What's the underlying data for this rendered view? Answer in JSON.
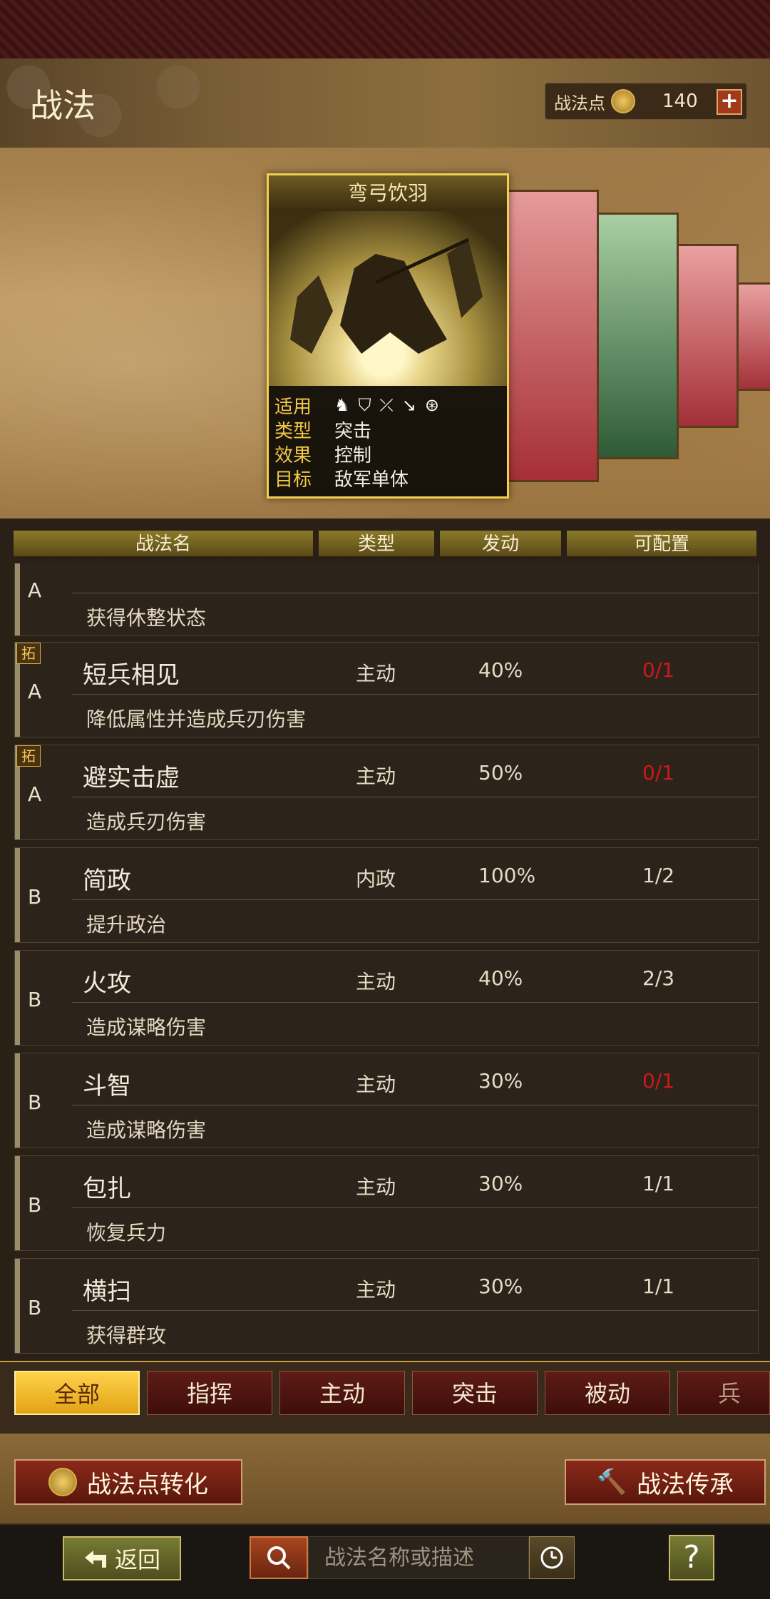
{
  "header": {
    "title": "战法",
    "points_label": "战法点",
    "points_value": "140",
    "plus_label": "+"
  },
  "featured_card": {
    "name": "弯弓饮羽",
    "info": [
      {
        "key": "适用",
        "value": ""
      },
      {
        "key": "类型",
        "value": "突击"
      },
      {
        "key": "效果",
        "value": "控制"
      },
      {
        "key": "目标",
        "value": "敌军单体"
      }
    ],
    "troop_icons": [
      "cavalry-icon",
      "shield-icon",
      "bow-icon",
      "spear-icon",
      "chariot-icon"
    ]
  },
  "table": {
    "headers": {
      "name": "战法名",
      "type": "类型",
      "activation": "发动",
      "configurable": "可配置"
    },
    "rows": [
      {
        "grade": "A",
        "tag": "",
        "name": "",
        "type": "",
        "activation": "",
        "configurable": "",
        "conf_red": false,
        "desc": "获得休整状态"
      },
      {
        "grade": "A",
        "tag": "拓",
        "name": "短兵相见",
        "type": "主动",
        "activation": "40%",
        "configurable": "0/1",
        "conf_red": true,
        "desc": "降低属性并造成兵刃伤害"
      },
      {
        "grade": "A",
        "tag": "拓",
        "name": "避实击虚",
        "type": "主动",
        "activation": "50%",
        "configurable": "0/1",
        "conf_red": true,
        "desc": "造成兵刃伤害"
      },
      {
        "grade": "B",
        "tag": "",
        "name": "简政",
        "type": "内政",
        "activation": "100%",
        "configurable": "1/2",
        "conf_red": false,
        "desc": "提升政治"
      },
      {
        "grade": "B",
        "tag": "",
        "name": "火攻",
        "type": "主动",
        "activation": "40%",
        "configurable": "2/3",
        "conf_red": false,
        "desc": "造成谋略伤害"
      },
      {
        "grade": "B",
        "tag": "",
        "name": "斗智",
        "type": "主动",
        "activation": "30%",
        "configurable": "0/1",
        "conf_red": true,
        "desc": "造成谋略伤害"
      },
      {
        "grade": "B",
        "tag": "",
        "name": "包扎",
        "type": "主动",
        "activation": "30%",
        "configurable": "1/1",
        "conf_red": false,
        "desc": "恢复兵力"
      },
      {
        "grade": "B",
        "tag": "",
        "name": "横扫",
        "type": "主动",
        "activation": "30%",
        "configurable": "1/1",
        "conf_red": false,
        "desc": "获得群攻"
      }
    ]
  },
  "filters": {
    "tabs": [
      "全部",
      "指挥",
      "主动",
      "突击",
      "被动",
      "兵"
    ],
    "active": "全部"
  },
  "actions": {
    "convert_label": "战法点转化",
    "inherit_label": "战法传承"
  },
  "bottom": {
    "back_label": "返回",
    "search_placeholder": "战法名称或描述",
    "help_label": "?"
  }
}
